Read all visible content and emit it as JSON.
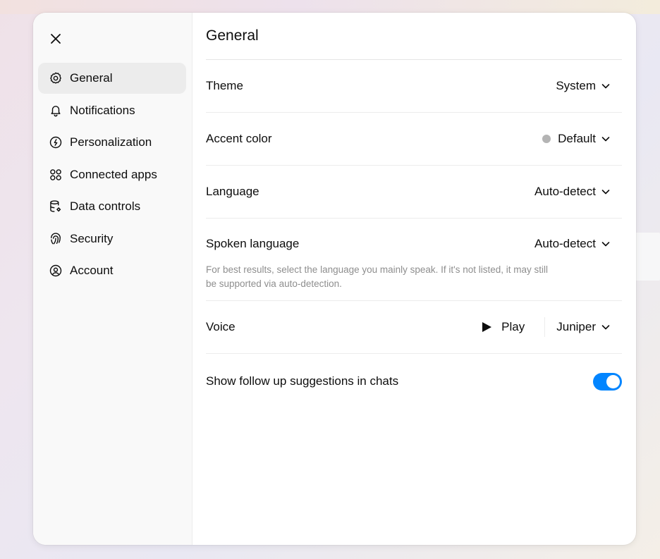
{
  "colors": {
    "accent": "#0285ff",
    "accent_dot": "#b4b4b4",
    "sidebar_bg": "#f9f9f9",
    "active_bg": "#ececec"
  },
  "close_icon": "close-icon",
  "sidebar": {
    "items": [
      {
        "label": "General",
        "icon": "gear-icon",
        "active": true
      },
      {
        "label": "Notifications",
        "icon": "bell-icon",
        "active": false
      },
      {
        "label": "Personalization",
        "icon": "personalization-icon",
        "active": false
      },
      {
        "label": "Connected apps",
        "icon": "apps-icon",
        "active": false
      },
      {
        "label": "Data controls",
        "icon": "database-icon",
        "active": false
      },
      {
        "label": "Security",
        "icon": "fingerprint-icon",
        "active": false
      },
      {
        "label": "Account",
        "icon": "user-circle-icon",
        "active": false
      }
    ]
  },
  "main": {
    "title": "General",
    "theme": {
      "label": "Theme",
      "value": "System"
    },
    "accent": {
      "label": "Accent color",
      "value": "Default"
    },
    "language": {
      "label": "Language",
      "value": "Auto-detect"
    },
    "spoken": {
      "label": "Spoken language",
      "value": "Auto-detect",
      "hint": "For best results, select the language you mainly speak. If it's not listed, it may still be supported via auto-detection."
    },
    "voice": {
      "label": "Voice",
      "play": "Play",
      "value": "Juniper"
    },
    "suggestions": {
      "label": "Show follow up suggestions in chats",
      "enabled": true
    }
  }
}
